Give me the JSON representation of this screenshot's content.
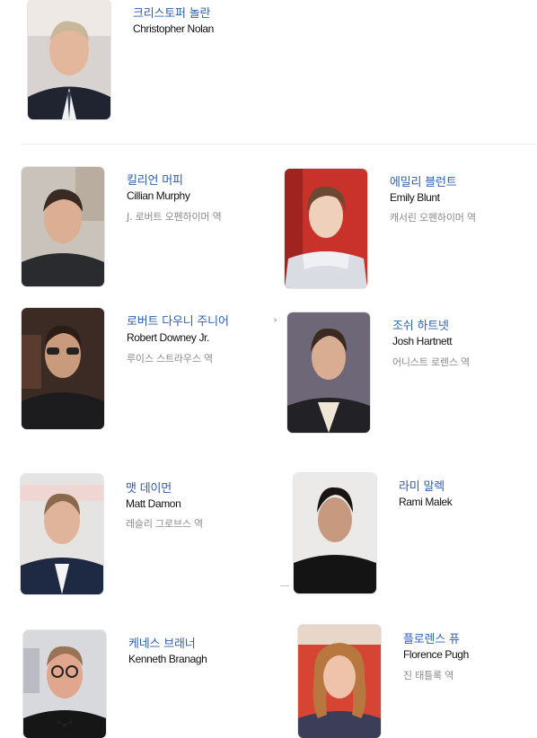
{
  "director": {
    "name_ko": "크리스토퍼 놀란",
    "name_en": "Christopher Nolan"
  },
  "cast": [
    {
      "name_ko": "킬리언 머피",
      "name_en": "Cillian Murphy",
      "role": "J. 로버트 오펜하이머 역"
    },
    {
      "name_ko": "에밀리 블런트",
      "name_en": "Emily Blunt",
      "role": "캐서린 오펜하이머 역"
    },
    {
      "name_ko": "로버트 다우니 주니어",
      "name_en": "Robert Downey Jr.",
      "role": "루이스 스트라우스 역"
    },
    {
      "name_ko": "조쉬 하트넷",
      "name_en": "Josh Hartnett",
      "role": "어니스트 로렌스 역"
    },
    {
      "name_ko": "맷 데이먼",
      "name_en": "Matt Damon",
      "role": "레슬리 그로브스 역"
    },
    {
      "name_ko": "라미 말렉",
      "name_en": "Rami Malek",
      "role": ""
    },
    {
      "name_ko": "케네스 브래너",
      "name_en": "Kenneth Branagh",
      "role": ""
    },
    {
      "name_ko": "플로렌스 퓨",
      "name_en": "Florence Pugh",
      "role": "진 태틀록 역"
    }
  ]
}
